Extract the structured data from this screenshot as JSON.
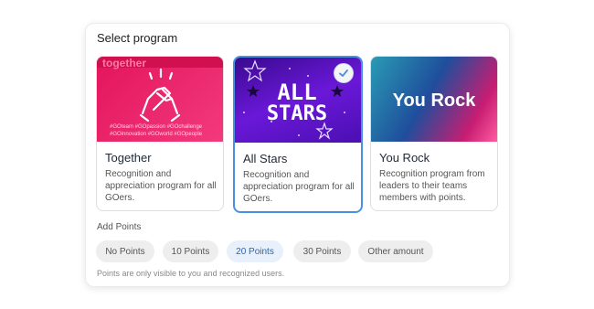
{
  "title": "Select program",
  "programs": [
    {
      "name": "Together",
      "description": "Recognition and appreciation program for all GOers.",
      "image_text": "together",
      "hashtags_line1": "#GOteam #GOpassion #GOchallenge",
      "hashtags_line2": "#GOinnovation #GOworld #GOpeople"
    },
    {
      "name": "All Stars",
      "description": "Recognition and appreciation program for all GOers.",
      "image_text_line1": "ALL",
      "image_text_line2": "STARS",
      "selected": true
    },
    {
      "name": "You Rock",
      "description": "Recognition program from leaders to their teams members with points.",
      "image_text": "You Rock"
    }
  ],
  "add_points": {
    "label": "Add Points",
    "options": [
      "No Points",
      "10 Points",
      "20 Points",
      "30 Points",
      "Other amount"
    ],
    "selected": "20 Points"
  },
  "note": "Points are only visible to you and recognized users.",
  "colors": {
    "accent": "#4a90e2",
    "selected_pill_bg": "#e7f0fb",
    "selected_pill_text": "#2c64b8"
  },
  "icons": {
    "together": "handshake-icon",
    "selected": "checkmark-icon"
  }
}
